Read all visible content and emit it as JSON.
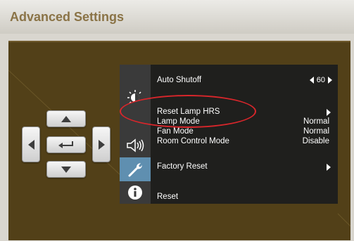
{
  "header": {
    "title": "Advanced Settings"
  },
  "menu": {
    "auto_shutoff": {
      "label": "Auto Shutoff",
      "value": "60"
    },
    "reset_lamp_hrs": {
      "label": "Reset Lamp HRS"
    },
    "lamp_mode": {
      "label": "Lamp Mode",
      "value": "Normal"
    },
    "fan_mode": {
      "label": "Fan Mode",
      "value": "Normal"
    },
    "room_control_mode": {
      "label": "Room Control Mode",
      "value": "Disable"
    },
    "factory_reset": {
      "label": "Factory Reset"
    },
    "reset": {
      "label": "Reset"
    }
  },
  "icons": [
    "brightness-icon",
    "speaker-icon",
    "wrench-icon",
    "info-icon"
  ],
  "colors": {
    "panel": "#524018",
    "menu_bg": "#1f1f1d",
    "icon_strip": "#3a3a3a",
    "active_icon": "#5f8fb0",
    "annotation": "#d8262b",
    "title": "#8a7346"
  }
}
